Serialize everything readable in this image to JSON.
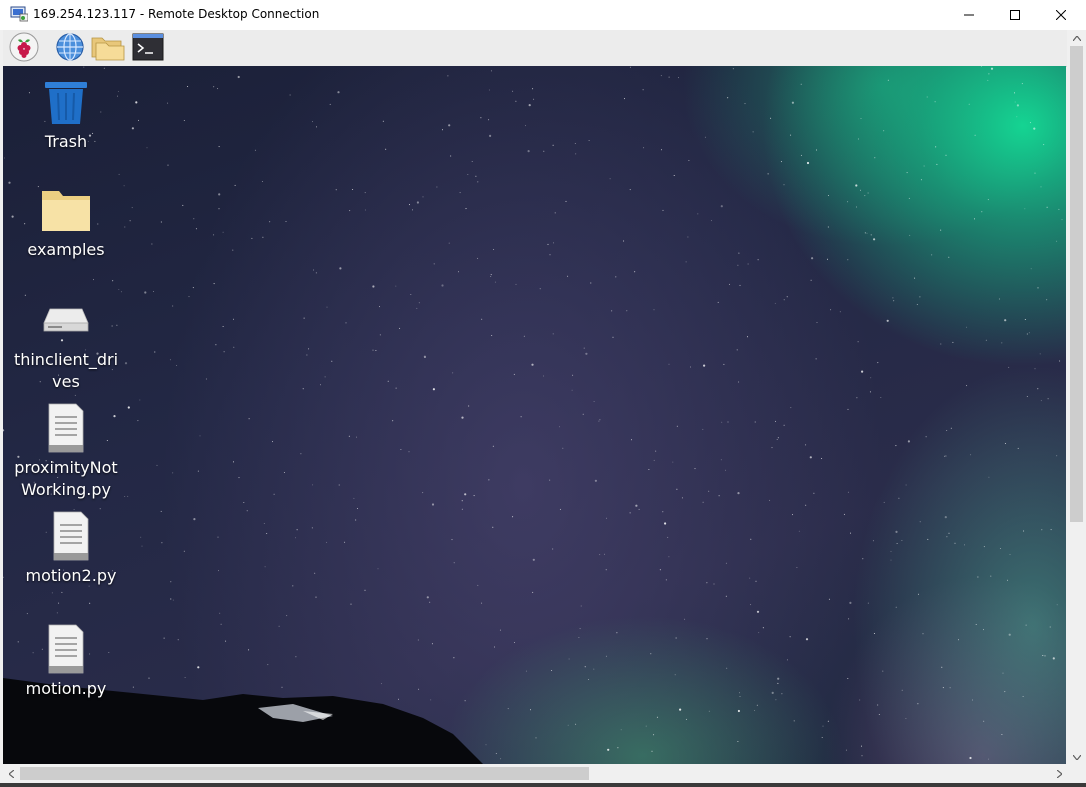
{
  "window": {
    "title": "169.254.123.117 - Remote Desktop Connection",
    "minimize_icon": "minimize-icon",
    "maximize_icon": "maximize-icon",
    "close_icon": "close-icon"
  },
  "panel": {
    "items": [
      {
        "icon": "raspberry-menu-icon"
      },
      {
        "icon": "web-browser-icon"
      },
      {
        "icon": "file-manager-icon"
      },
      {
        "icon": "terminal-icon"
      }
    ]
  },
  "desktop": {
    "items": [
      {
        "label": "Trash",
        "icon": "trash-icon"
      },
      {
        "label": "examples",
        "icon": "folder-icon"
      },
      {
        "label": "thinclient_drives",
        "icon": "drive-icon"
      },
      {
        "label": "proximityNotWorking.py",
        "icon": "text-file-icon"
      },
      {
        "label": "motion2.py",
        "icon": "text-file-icon"
      },
      {
        "label": "motion.py",
        "icon": "text-file-icon"
      }
    ]
  },
  "colors": {
    "aurora": "#14dc96",
    "sky": "#232845",
    "titlebar": "#ffffff",
    "panel": "#ececec"
  }
}
